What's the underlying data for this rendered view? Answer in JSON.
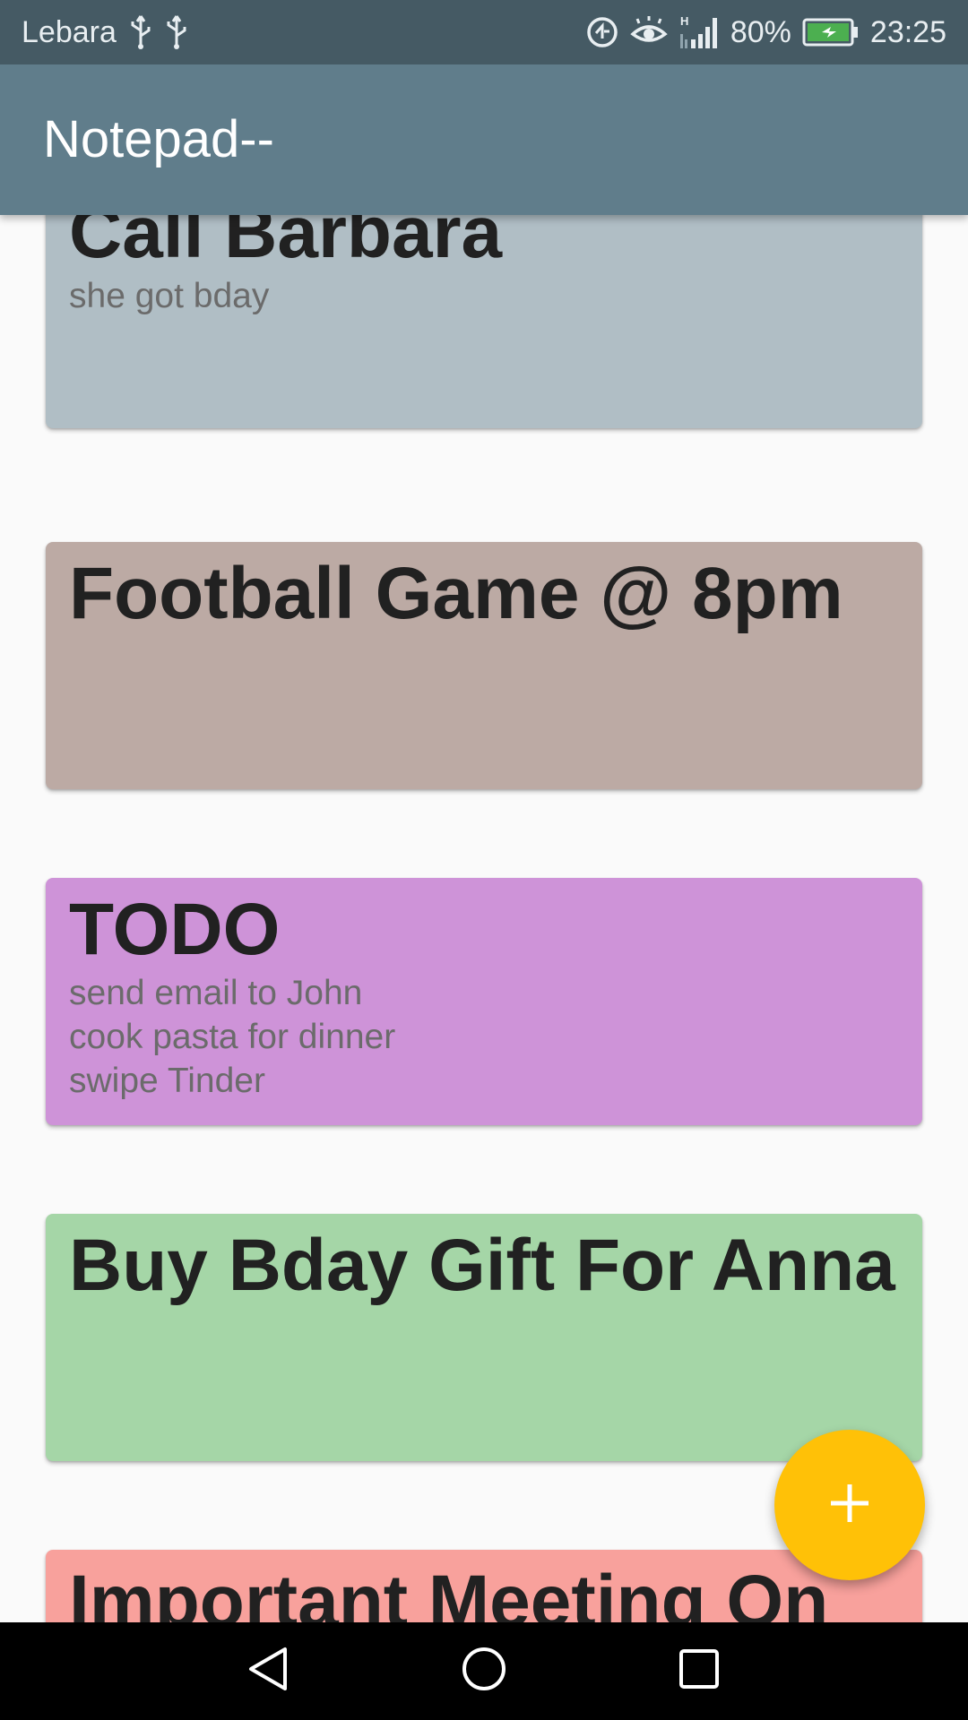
{
  "status_bar": {
    "carrier": "Lebara",
    "battery_percent": "80%",
    "time": "23:25",
    "icons": [
      "usb-icon",
      "usb-icon",
      "data-saver-icon",
      "eye-comfort-icon",
      "signal-icon",
      "battery-charging-icon"
    ]
  },
  "app_bar": {
    "title": "Notepad--",
    "color": "#607d8b"
  },
  "notes": [
    {
      "title": "Call Barbara",
      "body": "she got bday",
      "color": "#b0bec5"
    },
    {
      "title": "Football Game @ 8pm",
      "body": "",
      "color": "#bcaaa4"
    },
    {
      "title": "TODO",
      "body": "send email to John\ncook pasta for dinner\nswipe Tinder",
      "color": "#ce93d8"
    },
    {
      "title": "Buy Bday Gift For Anna",
      "body": "",
      "color": "#a5d6a7"
    },
    {
      "title": "Important Meeting On",
      "body": "",
      "color": "#f8a19c"
    }
  ],
  "fab": {
    "icon": "plus-icon",
    "color": "#ffc107"
  },
  "nav_bar": {
    "icons": [
      "back-icon",
      "home-icon",
      "recents-icon"
    ]
  }
}
